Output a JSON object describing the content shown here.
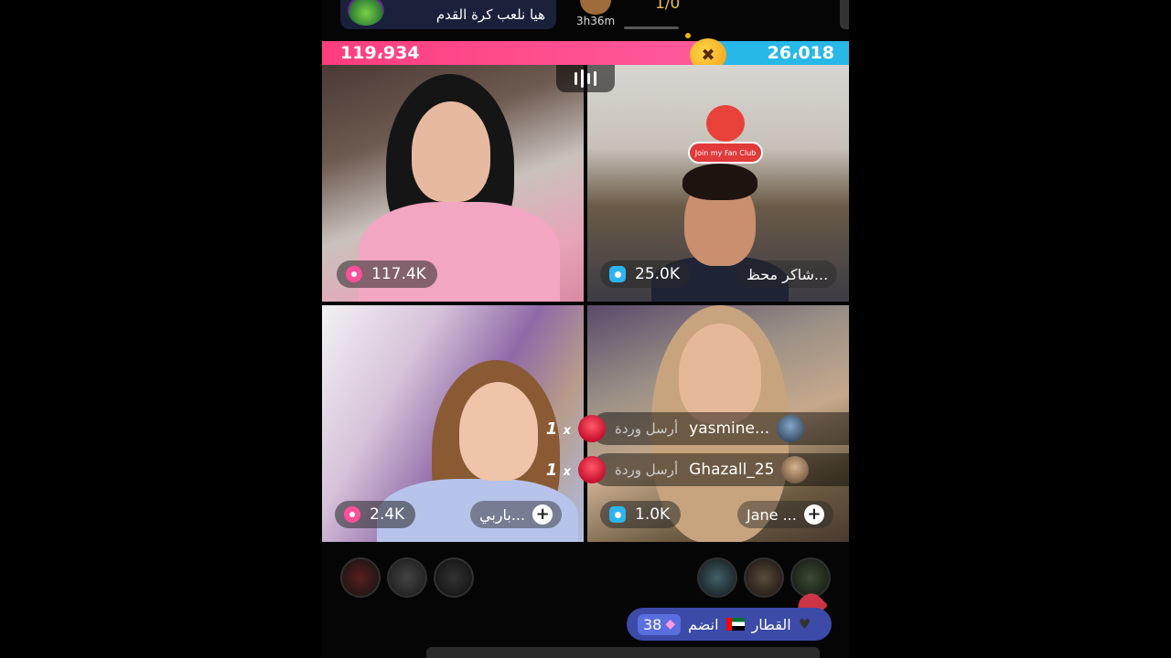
{
  "top": {
    "banner_text": "هيا نلعب كرة القدم",
    "timer": "3h36m",
    "mini_score": "1/0"
  },
  "battle": {
    "left_score": "119،934",
    "right_score": "26،018",
    "left_color": "#ff3d7f",
    "right_color": "#28b8e8"
  },
  "tiles": [
    {
      "score": "117.4K",
      "score_icon": "pink-gem-icon"
    },
    {
      "score": "25.0K",
      "score_icon": "blue-camera-icon",
      "name": "شاكر محظ..."
    },
    {
      "score": "2.4K",
      "score_icon": "pink-gem-icon",
      "name": "باربي..."
    },
    {
      "score": "1.0K",
      "score_icon": "blue-camera-icon",
      "name": "Jane ..."
    }
  ],
  "fan_club": {
    "label": "Join my Fan Club"
  },
  "gifts": [
    {
      "count": "1",
      "x": "x",
      "sent": "أرسل وردة",
      "user": "yasmine..."
    },
    {
      "count": "1",
      "x": "x",
      "sent": "أرسل وردة",
      "user": "Ghazall_25"
    }
  ],
  "join": {
    "count": "38",
    "text": "انضم",
    "team": "القطار"
  }
}
